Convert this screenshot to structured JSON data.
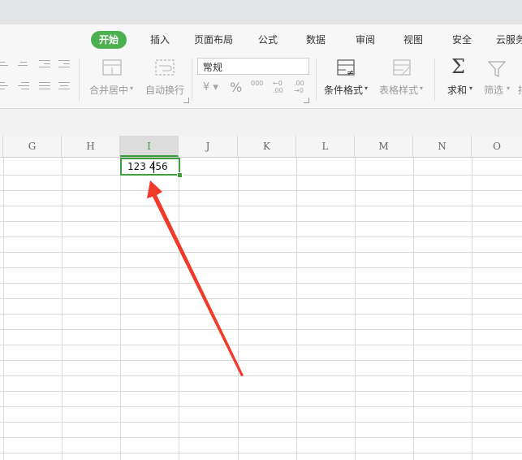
{
  "tabs": {
    "start": "开始",
    "insert": "插入",
    "page_layout": "页面布局",
    "formulas": "公式",
    "data": "数据",
    "review": "审阅",
    "view": "视图",
    "security": "安全",
    "cloud_service": "云服务"
  },
  "toolbar": {
    "merge_center": "合并居中",
    "wrap_text": "自动换行",
    "number_format": "常规",
    "currency_symbol": "¥",
    "percent_symbol": "%",
    "thousands_symbol": "000",
    "decrease_decimal": "←0 .00",
    "increase_decimal": ".00 →0",
    "conditional_format": "条件格式",
    "table_style": "表格样式",
    "sum": "求和",
    "filter": "筛选"
  },
  "columns": [
    "G",
    "H",
    "I",
    "J",
    "K",
    "L",
    "M",
    "N",
    "O"
  ],
  "selected_column": "I",
  "active_cell": {
    "text": "123 456"
  },
  "colors": {
    "accent": "#4caf50",
    "selection": "#3f9f3f",
    "arrow": "#f03a2a"
  }
}
